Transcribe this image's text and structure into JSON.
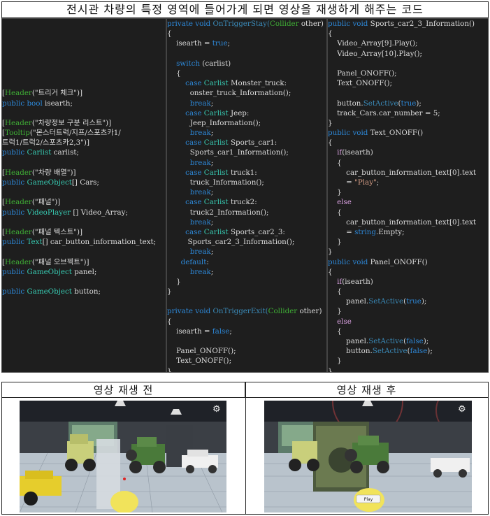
{
  "title": "전시관 차량의 특정 영역에 들어가게 되면 영상을 재생하게 해주는 코드",
  "code_col1": [
    [],
    [],
    [],
    [],
    [],
    [],
    [],
    [
      [
        "[",
        "wt"
      ],
      [
        "Header",
        "gr"
      ],
      [
        "(\"트리거 체크\")]",
        "wt"
      ]
    ],
    [
      [
        "public ",
        "ck"
      ],
      [
        "bool ",
        "ck"
      ],
      [
        "isearth;",
        "wt"
      ]
    ],
    [],
    [
      [
        "[",
        "wt"
      ],
      [
        "Header",
        "gr"
      ],
      [
        "(\"차량정보 구분 리스트\")]",
        "wt"
      ]
    ],
    [
      [
        "[",
        "wt"
      ],
      [
        "Tooltip",
        "gr"
      ],
      [
        "(\"몬스터트럭/지프/스포츠카1/",
        "wt"
      ]
    ],
    [
      [
        "트럭1/트럭2/스포츠카2,3\")]",
        "wt"
      ]
    ],
    [
      [
        "public ",
        "ck"
      ],
      [
        "Carlist ",
        "tl"
      ],
      [
        "carlist;",
        "wt"
      ]
    ],
    [],
    [
      [
        "[",
        "wt"
      ],
      [
        "Header",
        "gr"
      ],
      [
        "(\"차량 배열\")]",
        "wt"
      ]
    ],
    [
      [
        "public ",
        "ck"
      ],
      [
        "GameObject",
        "tl"
      ],
      [
        "[] Cars;",
        "wt"
      ]
    ],
    [],
    [
      [
        "[",
        "wt"
      ],
      [
        "Header",
        "gr"
      ],
      [
        "(\"패널\")]",
        "wt"
      ]
    ],
    [
      [
        "public ",
        "ck"
      ],
      [
        "VideoPlayer ",
        "tl"
      ],
      [
        "[] Video_Array;",
        "wt"
      ]
    ],
    [],
    [
      [
        "[",
        "wt"
      ],
      [
        "Header",
        "gr"
      ],
      [
        "(\"패널 텍스트\")]",
        "wt"
      ]
    ],
    [
      [
        "public ",
        "ck"
      ],
      [
        "Text",
        "tl"
      ],
      [
        "[] car_button_information_text;",
        "wt"
      ]
    ],
    [],
    [
      [
        "[",
        "wt"
      ],
      [
        "Header",
        "gr"
      ],
      [
        "(\"패널 오브젝트\")]",
        "wt"
      ]
    ],
    [
      [
        "public ",
        "ck"
      ],
      [
        "GameObject ",
        "tl"
      ],
      [
        "panel;",
        "wt"
      ]
    ],
    [],
    [
      [
        "public ",
        "ck"
      ],
      [
        "GameObject ",
        "tl"
      ],
      [
        "button;",
        "wt"
      ]
    ]
  ],
  "code_col2": [
    [
      [
        "private ",
        "ck"
      ],
      [
        "void ",
        "ck"
      ],
      [
        "OnTriggerStay(",
        "lk"
      ],
      [
        "Collider ",
        "gr"
      ],
      [
        "other)",
        "wt"
      ]
    ],
    [
      [
        "{",
        "wt"
      ]
    ],
    [
      [
        "    isearth = ",
        "wt"
      ],
      [
        "true",
        "ck"
      ],
      [
        ";",
        "wt"
      ]
    ],
    [],
    [
      [
        "    switch ",
        "ck"
      ],
      [
        "(carlist)",
        "wt"
      ]
    ],
    [
      [
        "    {",
        "wt"
      ]
    ],
    [
      [
        "        case ",
        "ck"
      ],
      [
        "Carlist ",
        "tl"
      ],
      [
        "Monster_truck:",
        "wt"
      ]
    ],
    [
      [
        "          onster_truck_Information();",
        "wt"
      ]
    ],
    [
      [
        "          break",
        "ck"
      ],
      [
        ";",
        "wt"
      ]
    ],
    [
      [
        "        case ",
        "ck"
      ],
      [
        "Carlist ",
        "tl"
      ],
      [
        "Jeep:",
        "wt"
      ]
    ],
    [
      [
        "          Jeep_Information();",
        "wt"
      ]
    ],
    [
      [
        "          break",
        "ck"
      ],
      [
        ";",
        "wt"
      ]
    ],
    [
      [
        "        case ",
        "ck"
      ],
      [
        "Carlist ",
        "tl"
      ],
      [
        "Sports_car1:",
        "wt"
      ]
    ],
    [
      [
        "          Sports_car1_Information();",
        "wt"
      ]
    ],
    [
      [
        "          break",
        "ck"
      ],
      [
        ";",
        "wt"
      ]
    ],
    [
      [
        "        case ",
        "ck"
      ],
      [
        "Carlist ",
        "tl"
      ],
      [
        "truck1:",
        "wt"
      ]
    ],
    [
      [
        "          truck_Information();",
        "wt"
      ]
    ],
    [
      [
        "          break",
        "ck"
      ],
      [
        ";",
        "wt"
      ]
    ],
    [
      [
        "        case ",
        "ck"
      ],
      [
        "Carlist ",
        "tl"
      ],
      [
        "truck2:",
        "wt"
      ]
    ],
    [
      [
        "          truck2_Information();",
        "wt"
      ]
    ],
    [
      [
        "          break",
        "ck"
      ],
      [
        ";",
        "wt"
      ]
    ],
    [
      [
        "        case ",
        "ck"
      ],
      [
        "Carlist ",
        "tl"
      ],
      [
        "Sports_car2_3:",
        "wt"
      ]
    ],
    [
      [
        "         Sports_car2_3_Information();",
        "wt"
      ]
    ],
    [
      [
        "          break",
        "ck"
      ],
      [
        ";",
        "wt"
      ]
    ],
    [
      [
        "      default",
        "ck"
      ],
      [
        ":",
        "wt"
      ]
    ],
    [
      [
        "          break",
        "ck"
      ],
      [
        ";",
        "wt"
      ]
    ],
    [
      [
        "    }",
        "wt"
      ]
    ],
    [
      [
        "}",
        "wt"
      ]
    ],
    [],
    [
      [
        "private ",
        "ck"
      ],
      [
        "void ",
        "ck"
      ],
      [
        "OnTriggerExit(",
        "lk"
      ],
      [
        "Collider ",
        "gr"
      ],
      [
        "other)",
        "wt"
      ]
    ],
    [
      [
        "{",
        "wt"
      ]
    ],
    [
      [
        "    isearth = ",
        "wt"
      ],
      [
        "false",
        "ck"
      ],
      [
        ";",
        "wt"
      ]
    ],
    [],
    [
      [
        "    Panel_ONOFF();",
        "wt"
      ]
    ],
    [
      [
        "    Text_ONOFF();",
        "wt"
      ]
    ],
    [
      [
        "}",
        "wt"
      ]
    ]
  ],
  "code_col3": [
    [
      [
        "public ",
        "ck"
      ],
      [
        "void ",
        "ck"
      ],
      [
        "Sports_car2_3_Information()",
        "wt"
      ]
    ],
    [
      [
        "{",
        "wt"
      ]
    ],
    [
      [
        "    Video_Array[9].Play();",
        "wt"
      ]
    ],
    [
      [
        "    Video_Array[10].Play();",
        "wt"
      ]
    ],
    [],
    [
      [
        "    Panel_ONOFF();",
        "wt"
      ]
    ],
    [
      [
        "    Text_ONOFF();",
        "wt"
      ]
    ],
    [],
    [
      [
        "    button.",
        "wt"
      ],
      [
        "SetActive",
        "lk"
      ],
      [
        "(",
        "wt"
      ],
      [
        "true",
        "ck"
      ],
      [
        ");",
        "wt"
      ]
    ],
    [
      [
        "    track_Cars.car_number = 5;",
        "wt"
      ]
    ],
    [
      [
        "}",
        "wt"
      ]
    ],
    [
      [
        "public ",
        "ck"
      ],
      [
        "void ",
        "ck"
      ],
      [
        "Text_ONOFF()",
        "wt"
      ]
    ],
    [
      [
        "{",
        "wt"
      ]
    ],
    [
      [
        "    if",
        "mg"
      ],
      [
        "(isearth)",
        "wt"
      ]
    ],
    [
      [
        "    {",
        "wt"
      ]
    ],
    [
      [
        "        car_button_information_text[0].text",
        "wt"
      ]
    ],
    [
      [
        "        = ",
        "wt"
      ],
      [
        "\"Play\"",
        "st"
      ],
      [
        ";",
        "wt"
      ]
    ],
    [
      [
        "    }",
        "wt"
      ]
    ],
    [
      [
        "    else",
        "mg"
      ]
    ],
    [
      [
        "    {",
        "wt"
      ]
    ],
    [
      [
        "        car_button_information_text[0].text",
        "wt"
      ]
    ],
    [
      [
        "        = ",
        "wt"
      ],
      [
        "string",
        "ck"
      ],
      [
        ".Empty;",
        "wt"
      ]
    ],
    [
      [
        "    }",
        "wt"
      ]
    ],
    [
      [
        "}",
        "wt"
      ]
    ],
    [
      [
        "public ",
        "ck"
      ],
      [
        "void ",
        "ck"
      ],
      [
        "Panel_ONOFF()",
        "wt"
      ]
    ],
    [
      [
        "{",
        "wt"
      ]
    ],
    [
      [
        "    if",
        "mg"
      ],
      [
        "(isearth)",
        "wt"
      ]
    ],
    [
      [
        "    {",
        "wt"
      ]
    ],
    [
      [
        "        panel.",
        "wt"
      ],
      [
        "SetActive",
        "lk"
      ],
      [
        "(",
        "wt"
      ],
      [
        "true",
        "ck"
      ],
      [
        ");",
        "wt"
      ]
    ],
    [
      [
        "    }",
        "wt"
      ]
    ],
    [
      [
        "    else",
        "mg"
      ]
    ],
    [
      [
        "    {",
        "wt"
      ]
    ],
    [
      [
        "        panel.",
        "wt"
      ],
      [
        "SetActive",
        "lk"
      ],
      [
        "(",
        "wt"
      ],
      [
        "false",
        "ck"
      ],
      [
        ");",
        "wt"
      ]
    ],
    [
      [
        "        button.",
        "wt"
      ],
      [
        "SetActive",
        "lk"
      ],
      [
        "(",
        "wt"
      ],
      [
        "false",
        "ck"
      ],
      [
        ");",
        "wt"
      ]
    ],
    [
      [
        "    }",
        "wt"
      ]
    ],
    [
      [
        "}",
        "wt"
      ]
    ]
  ],
  "images": {
    "before_label": "영상 재생 전",
    "after_label": "영상 재생 후",
    "play_button_label": "Play"
  }
}
